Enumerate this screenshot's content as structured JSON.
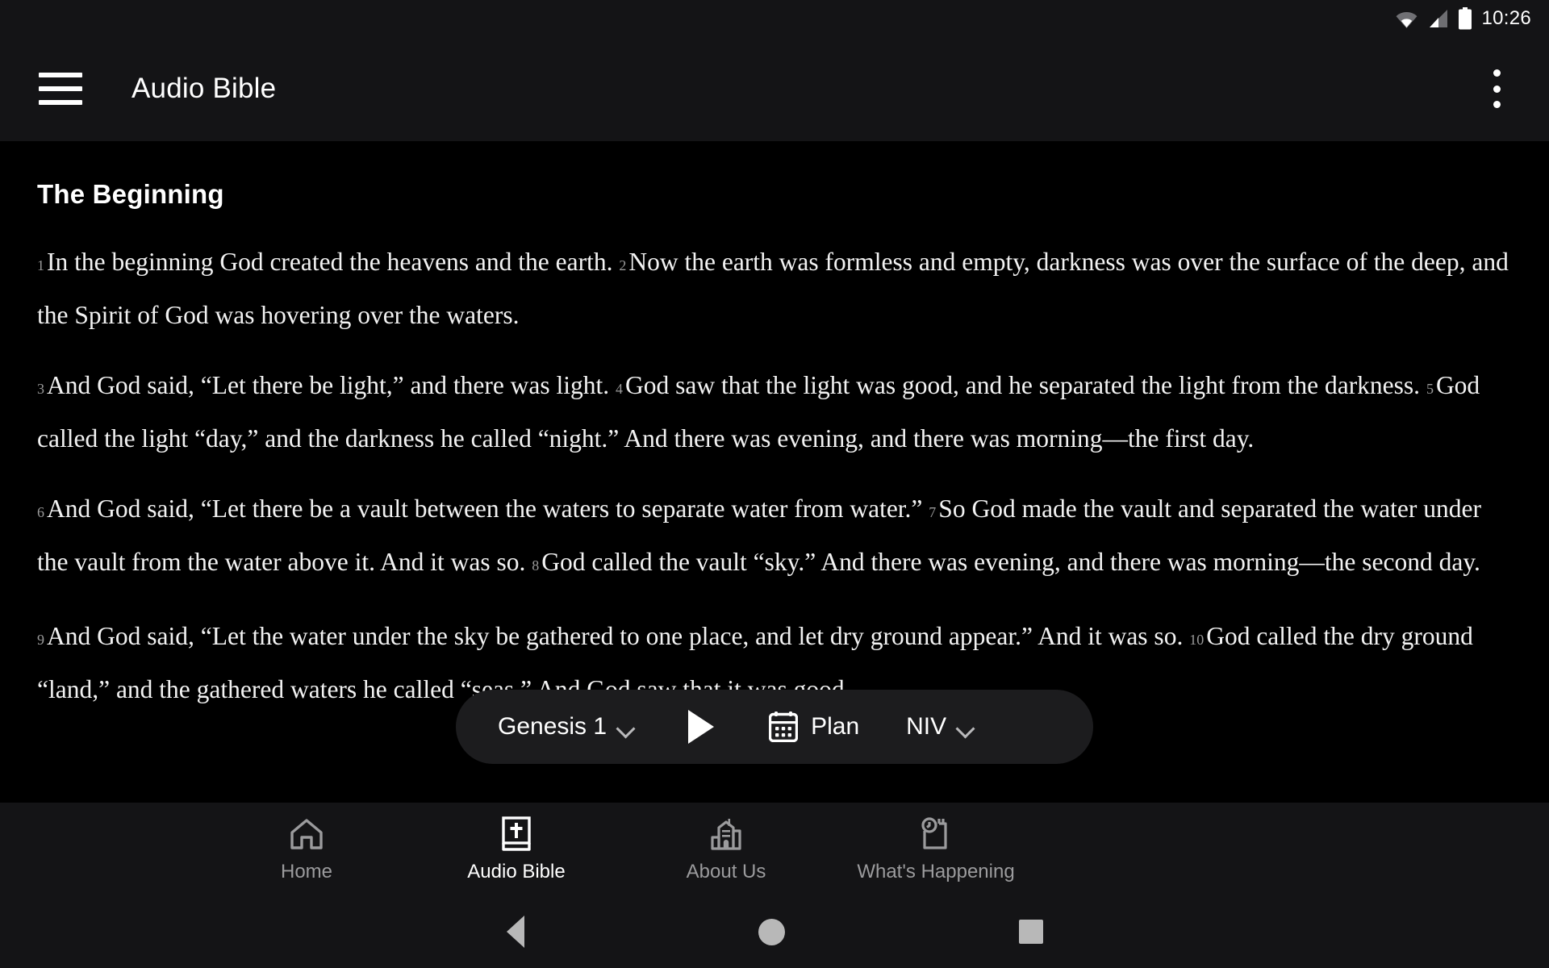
{
  "status_bar": {
    "time": "10:26",
    "icons": [
      "wifi-icon",
      "cellular-signal-icon",
      "battery-icon"
    ]
  },
  "app_bar": {
    "menu_icon": "hamburger-menu-icon",
    "title": "Audio Bible",
    "overflow_icon": "more-vertical-icon"
  },
  "reader": {
    "heading": "The Beginning",
    "paragraphs": [
      [
        {
          "num": "1",
          "text": "In the beginning God created the heavens and the earth."
        },
        {
          "num": "2",
          "text": "Now the earth was formless and empty, darkness was over the surface of the deep, and the Spirit of God was hovering over the waters."
        }
      ],
      [
        {
          "num": "3",
          "text": "And God said, “Let there be light,” and there was light."
        },
        {
          "num": "4",
          "text": "God saw that the light was good, and he separated the light from the darkness."
        },
        {
          "num": "5",
          "text": "God called the light “day,” and the darkness he called “night.” And there was evening, and there was morning—the first day."
        }
      ],
      [
        {
          "num": "6",
          "text": "And God said, “Let there be a vault between the waters to separate water from water.”"
        },
        {
          "num": "7",
          "text": "So God made the vault and separated the water under the vault from the water above it. And it was so."
        },
        {
          "num": "8",
          "text": "God called the vault “sky.” And there was evening, and there was morning—the second day."
        }
      ],
      [
        {
          "num": "9",
          "text": "And God said, “Let the water under the sky be gathered to one place, and let dry ground appear.” And it was so."
        },
        {
          "num": "10",
          "text": "God called the dry ground “land,” and the gathered waters he called “seas.” And God saw that it was good."
        }
      ]
    ]
  },
  "player": {
    "chapter": "Genesis 1",
    "chapter_chevron": "chevron-down-icon",
    "play_icon": "play-icon",
    "plan_icon": "calendar-icon",
    "plan_label": "Plan",
    "version": "NIV",
    "version_chevron": "chevron-down-icon"
  },
  "tabbar": {
    "tabs": [
      {
        "label": "Home",
        "icon": "home-icon",
        "active": false
      },
      {
        "label": "Audio Bible",
        "icon": "bible-book-icon",
        "active": true
      },
      {
        "label": "About Us",
        "icon": "church-building-icon",
        "active": false
      },
      {
        "label": "What's Happening",
        "icon": "event-clock-icon",
        "active": false
      }
    ]
  },
  "android_nav": {
    "back": "back-triangle-icon",
    "home": "home-circle-icon",
    "recents": "recents-square-icon"
  },
  "colors": {
    "background": "#000000",
    "chrome": "#141416",
    "player": "#1c1c1e",
    "text": "#ffffff",
    "muted": "#9b9b9d"
  }
}
